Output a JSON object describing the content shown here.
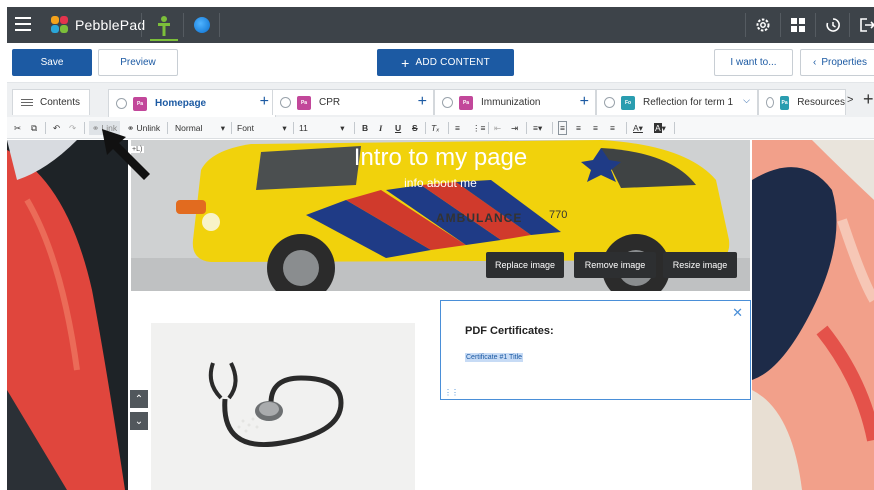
{
  "app": {
    "name": "PebblePad"
  },
  "actions": {
    "save": "Save",
    "preview": "Preview",
    "add_content": "ADD CONTENT",
    "add_content_icon": "plus-icon",
    "i_want_to": "I want to...",
    "properties": "Properties",
    "properties_icon": "chevron-left-icon"
  },
  "tabs": {
    "contents": "Contents",
    "pages": [
      {
        "label": "Homepage",
        "badge": "Pa",
        "badge_color": "#c2479a",
        "active": true
      },
      {
        "label": "CPR",
        "badge": "Pa",
        "badge_color": "#c2479a",
        "active": false
      },
      {
        "label": "Immunization",
        "badge": "Pa",
        "badge_color": "#c2479a",
        "active": false
      },
      {
        "label": "Reflection for term 1",
        "badge": "Fo",
        "badge_color": "#2a9db0",
        "active": false
      },
      {
        "label": "Resources",
        "badge": "Pa",
        "badge_color": "#2a9db0",
        "active": false
      }
    ]
  },
  "format_toolbar": {
    "link": "Link",
    "unlink": "Unlink",
    "style": "Normal",
    "font": "Font",
    "size": "11",
    "shortcut_hint": "+L)"
  },
  "hero": {
    "title": "Intro to my page",
    "subtitle": "info about me",
    "vehicle_text": "AMBULANCE",
    "vehicle_number": "770",
    "buttons": {
      "replace": "Replace image",
      "remove": "Remove image",
      "resize": "Resize image"
    }
  },
  "pdf_block": {
    "title": "PDF Certificates:",
    "item": "Certificate #1 Title"
  },
  "colors": {
    "primary": "#1c5aa3",
    "topbar": "#3d4349",
    "accent_green": "#7cbf3a",
    "selection_border": "#4a8fd8"
  }
}
